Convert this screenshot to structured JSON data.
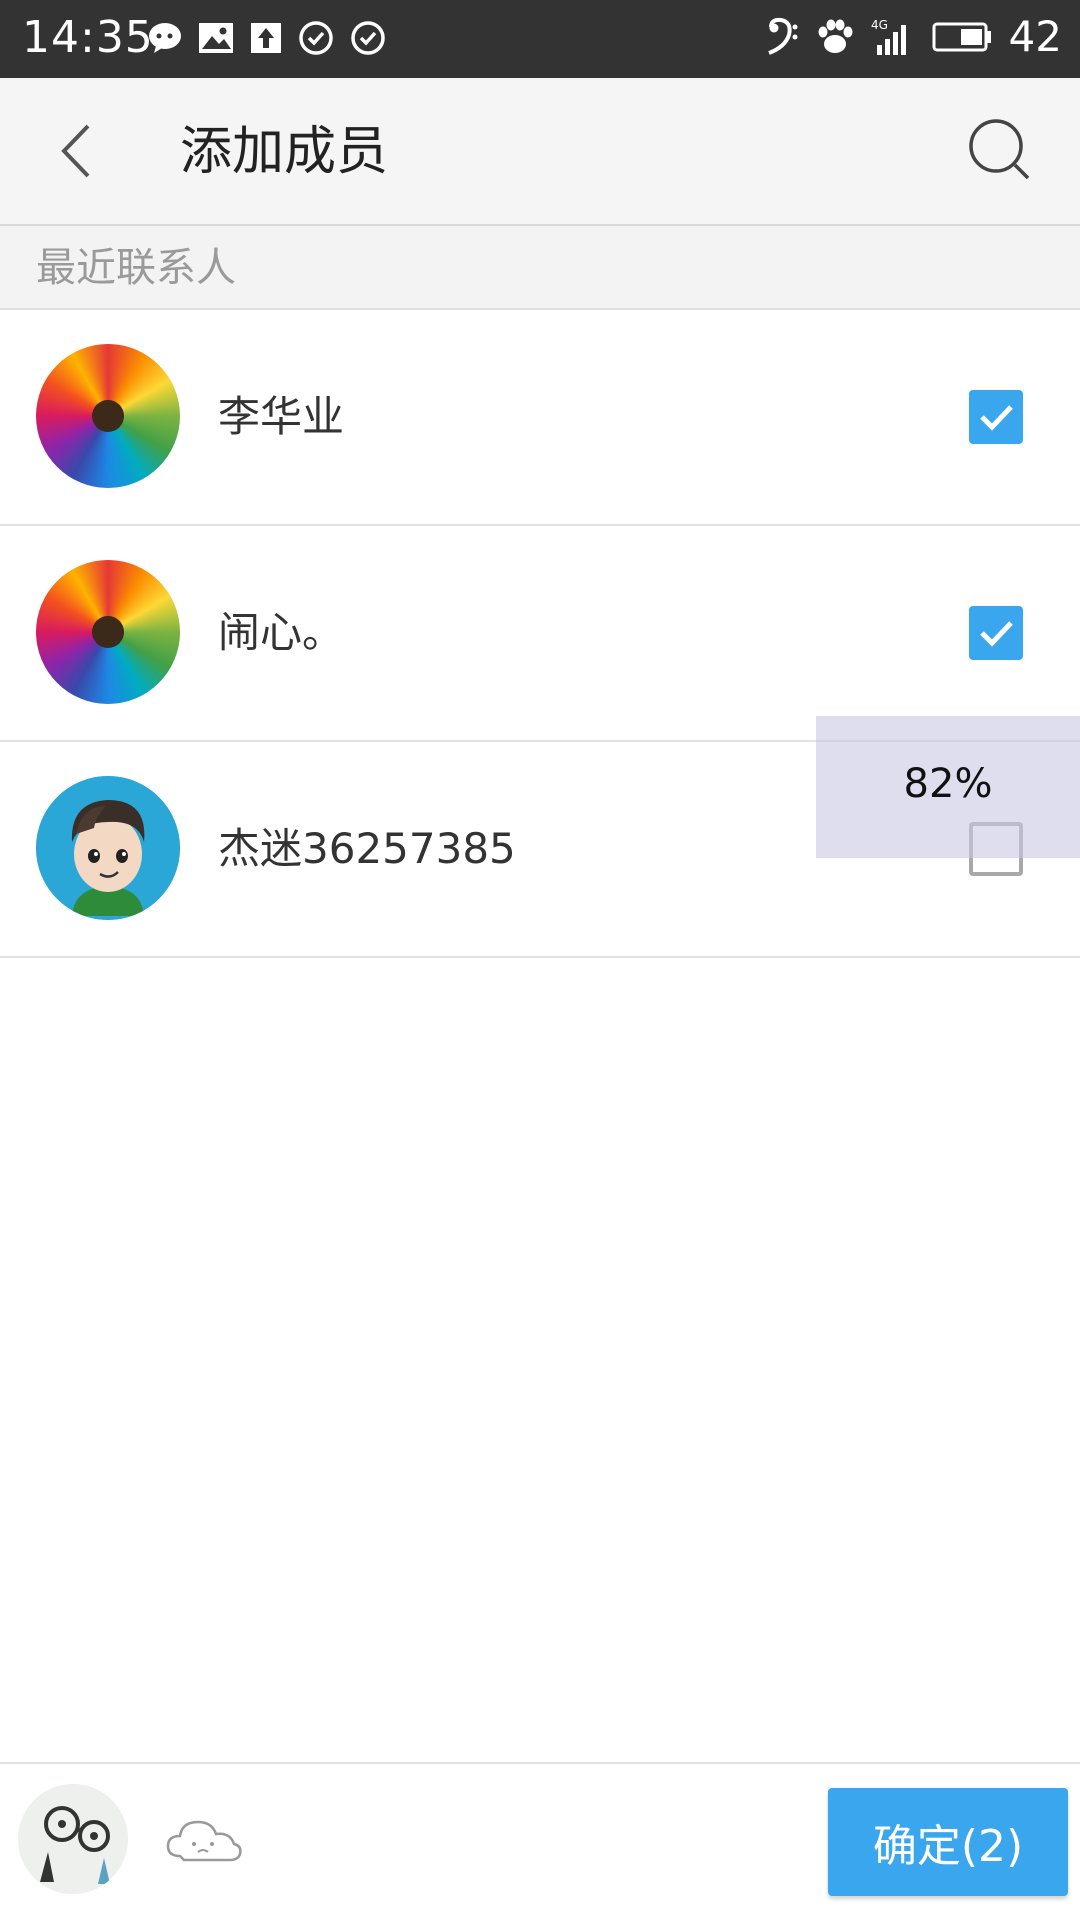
{
  "status_bar": {
    "time": "14:35",
    "battery_level": "42",
    "left_icons": [
      "message-bubble-icon",
      "image-icon",
      "upload-icon",
      "check-circle-icon",
      "check-circle-icon"
    ],
    "right_icons": [
      "music-clef-icon",
      "paw-icon",
      "4g-signal-icon",
      "battery-icon"
    ],
    "network_label": "4G"
  },
  "appbar": {
    "title": "添加成员",
    "back_icon": "chevron-left-icon",
    "search_icon": "search-icon"
  },
  "section": {
    "title": "最近联系人"
  },
  "contacts": [
    {
      "name": "李华业",
      "checked": true,
      "avatar": "colored-pencils-avatar"
    },
    {
      "name": "闹心。",
      "checked": true,
      "avatar": "colored-pencils-avatar"
    },
    {
      "name": "杰迷36257385",
      "checked": false,
      "avatar": "cartoon-boy-avatar"
    }
  ],
  "overlay": {
    "percent": "82%"
  },
  "bottom_bar": {
    "confirm_label": "确定(2)"
  },
  "colors": {
    "accent": "#3aa6ee",
    "status_bar": "#333333",
    "appbar": "#f5f5f5",
    "section_bg": "#f3f3f3",
    "checkbox_unchecked": "#a8a8a8"
  }
}
